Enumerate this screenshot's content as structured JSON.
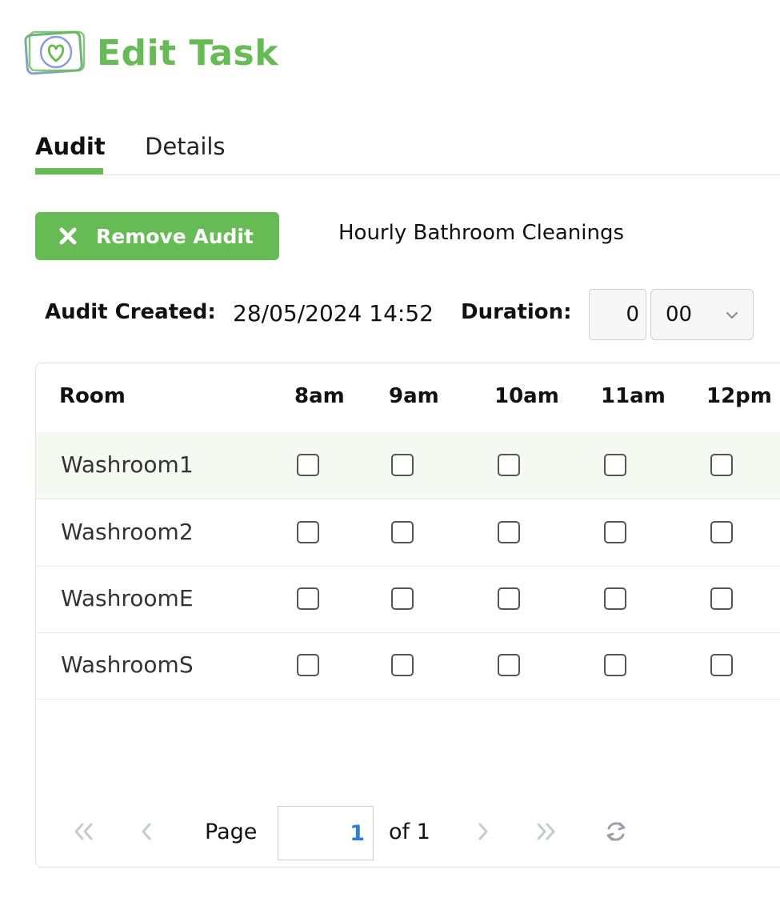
{
  "header": {
    "title": "Edit Task",
    "logo_icon": "heart-camera-logo-icon"
  },
  "tabs": [
    {
      "label": "Audit",
      "active": true
    },
    {
      "label": "Details",
      "active": false
    }
  ],
  "toolbar": {
    "remove_label": "Remove Audit",
    "audit_name": "Hourly Bathroom Cleanings"
  },
  "meta": {
    "created_label": "Audit Created:",
    "created_value": "28/05/2024 14:52",
    "duration_label": "Duration:",
    "duration_hours": "0",
    "duration_minutes": "00"
  },
  "table": {
    "columns": [
      "Room",
      "8am",
      "9am",
      "10am",
      "11am",
      "12pm"
    ],
    "rows": [
      {
        "room": "Washroom1",
        "checks": [
          false,
          false,
          false,
          false,
          false
        ]
      },
      {
        "room": "Washroom2",
        "checks": [
          false,
          false,
          false,
          false,
          false
        ]
      },
      {
        "room": "WashroomE",
        "checks": [
          false,
          false,
          false,
          false,
          false
        ]
      },
      {
        "room": "WashroomS",
        "checks": [
          false,
          false,
          false,
          false,
          false
        ]
      }
    ]
  },
  "pager": {
    "page_label": "Page",
    "page_value": "1",
    "of_label": "of 1"
  },
  "colors": {
    "accent": "#66bb55",
    "page_input": "#2a7fd4",
    "selected_row": "#f4f9f2"
  }
}
